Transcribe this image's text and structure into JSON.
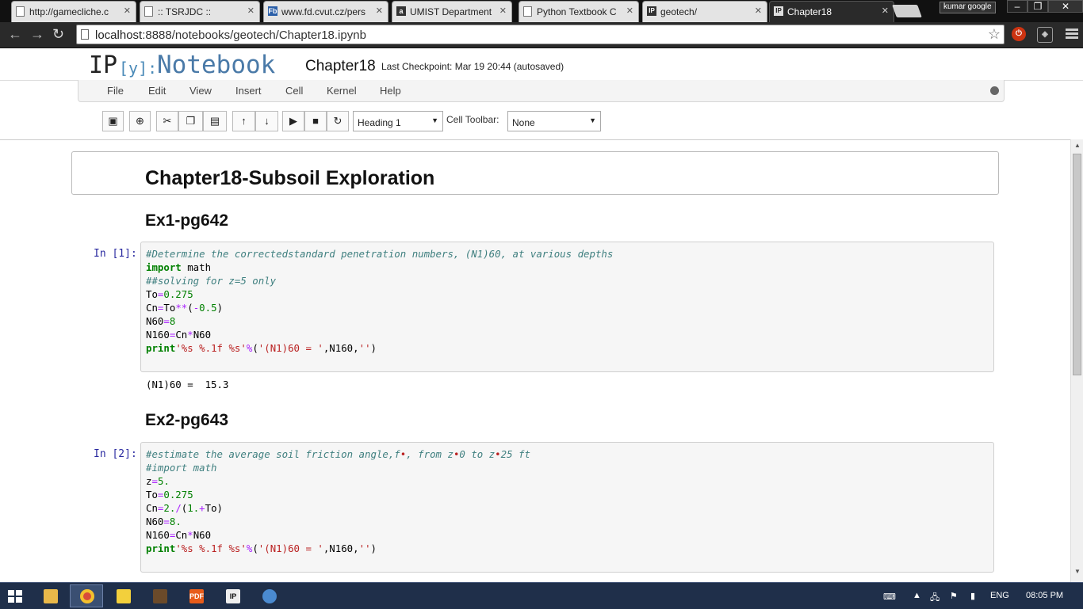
{
  "browser": {
    "tabs": [
      {
        "title": "http://gamecliche.c",
        "icon": "page-icon"
      },
      {
        "title": ":: TSRJDC ::",
        "icon": "page-icon"
      },
      {
        "title": "www.fd.cvut.cz/pers",
        "icon": "fd-icon"
      },
      {
        "title": "UMIST Department",
        "icon": "a-icon"
      },
      {
        "title": "Python Textbook C",
        "icon": "page-icon"
      },
      {
        "title": "geotech/",
        "icon": "ipython-icon"
      },
      {
        "title": "Chapter18",
        "icon": "ipython-icon",
        "active": true
      }
    ],
    "profile": "kumar google",
    "window_buttons": {
      "minimize": "–",
      "maximize": "❐",
      "close": "✕"
    },
    "url": {
      "host": "localhost",
      "rest": ":8888/notebooks/geotech/Chapter18.ipynb"
    }
  },
  "notebook": {
    "logo_ip": "IP",
    "logo_y": "[y]:",
    "logo_word": "Notebook",
    "name": "Chapter18",
    "checkpoint": "Last Checkpoint: Mar 19 20:44 (autosaved)",
    "menu": [
      "File",
      "Edit",
      "View",
      "Insert",
      "Cell",
      "Kernel",
      "Help"
    ],
    "toolbar": {
      "cell_type": "Heading 1",
      "cell_toolbar_label": "Cell Toolbar:",
      "cell_toolbar_value": "None"
    }
  },
  "cells": {
    "heading1": "Chapter18-Subsoil Exploration",
    "ex1": {
      "heading": "Ex1-pg642",
      "prompt": "In [1]:",
      "output": "(N1)60 =  15.3",
      "code": [
        [
          {
            "t": "#Determine the correctedstandard penetration numbers, (N1)60, at various depths",
            "c": "cm"
          }
        ],
        [
          {
            "t": "import",
            "c": "kw"
          },
          {
            "t": " math",
            "c": ""
          }
        ],
        [
          {
            "t": "##solving for z=5 only",
            "c": "cm"
          }
        ],
        [
          {
            "t": "To",
            "c": ""
          },
          {
            "t": "=",
            "c": "op"
          },
          {
            "t": "0.275",
            "c": "nm"
          }
        ],
        [
          {
            "t": "Cn",
            "c": ""
          },
          {
            "t": "=",
            "c": "op"
          },
          {
            "t": "To",
            "c": ""
          },
          {
            "t": "**",
            "c": "op"
          },
          {
            "t": "(",
            "c": ""
          },
          {
            "t": "-",
            "c": "op"
          },
          {
            "t": "0.5",
            "c": "nm"
          },
          {
            "t": ")",
            "c": ""
          }
        ],
        [
          {
            "t": "N60",
            "c": ""
          },
          {
            "t": "=",
            "c": "op"
          },
          {
            "t": "8",
            "c": "nm"
          }
        ],
        [
          {
            "t": "N160",
            "c": ""
          },
          {
            "t": "=",
            "c": "op"
          },
          {
            "t": "Cn",
            "c": ""
          },
          {
            "t": "*",
            "c": "op"
          },
          {
            "t": "N60",
            "c": ""
          }
        ],
        [
          {
            "t": "print",
            "c": "kw"
          },
          {
            "t": "'%s %.1f %s'",
            "c": "st"
          },
          {
            "t": "%",
            "c": "op"
          },
          {
            "t": "(",
            "c": ""
          },
          {
            "t": "'(N1)60 = '",
            "c": "st"
          },
          {
            "t": ",N160,",
            "c": ""
          },
          {
            "t": "''",
            "c": "st"
          },
          {
            "t": ")",
            "c": ""
          }
        ]
      ]
    },
    "ex2": {
      "heading": "Ex2-pg643",
      "prompt": "In [2]:",
      "code": [
        [
          {
            "t": "#estimate the average soil friction angle,f",
            "c": "cm"
          },
          {
            "t": "•",
            "c": "st"
          },
          {
            "t": ", from z",
            "c": "cm"
          },
          {
            "t": "•",
            "c": "st"
          },
          {
            "t": "0 to z",
            "c": "cm"
          },
          {
            "t": "•",
            "c": "st"
          },
          {
            "t": "25 ft",
            "c": "cm"
          }
        ],
        [
          {
            "t": "#import math",
            "c": "cm"
          }
        ],
        [
          {
            "t": "z",
            "c": ""
          },
          {
            "t": "=",
            "c": "op"
          },
          {
            "t": "5.",
            "c": "nm"
          }
        ],
        [
          {
            "t": "To",
            "c": ""
          },
          {
            "t": "=",
            "c": "op"
          },
          {
            "t": "0.275",
            "c": "nm"
          }
        ],
        [
          {
            "t": "Cn",
            "c": ""
          },
          {
            "t": "=",
            "c": "op"
          },
          {
            "t": "2.",
            "c": "nm"
          },
          {
            "t": "/",
            "c": "op"
          },
          {
            "t": "(",
            "c": ""
          },
          {
            "t": "1.",
            "c": "nm"
          },
          {
            "t": "+",
            "c": "op"
          },
          {
            "t": "To)",
            "c": ""
          }
        ],
        [
          {
            "t": "N60",
            "c": ""
          },
          {
            "t": "=",
            "c": "op"
          },
          {
            "t": "8.",
            "c": "nm"
          }
        ],
        [
          {
            "t": "N160",
            "c": ""
          },
          {
            "t": "=",
            "c": "op"
          },
          {
            "t": "Cn",
            "c": ""
          },
          {
            "t": "*",
            "c": "op"
          },
          {
            "t": "N60",
            "c": ""
          }
        ],
        [
          {
            "t": "print",
            "c": "kw"
          },
          {
            "t": "'%s %.1f %s'",
            "c": "st"
          },
          {
            "t": "%",
            "c": "op"
          },
          {
            "t": "(",
            "c": ""
          },
          {
            "t": "'(N1)60 = '",
            "c": "st"
          },
          {
            "t": ",N160,",
            "c": ""
          },
          {
            "t": "''",
            "c": "st"
          },
          {
            "t": ")",
            "c": ""
          }
        ]
      ]
    }
  },
  "taskbar": {
    "apps": [
      "file-explorer-icon",
      "chrome-icon",
      "sticky-notes-icon",
      "terminal-icon",
      "pdf-icon",
      "ipython-icon",
      "paint-icon"
    ],
    "app_labels": {
      "pdf": "PDF",
      "ipython": "IP"
    },
    "language": "ENG",
    "time": "08:05 PM"
  },
  "colors": {
    "comment": "#408080",
    "keyword": "#008000",
    "number": "#008000",
    "operator": "#aa22ff",
    "string": "#ba2121",
    "prompt": "#2a2aa0"
  }
}
